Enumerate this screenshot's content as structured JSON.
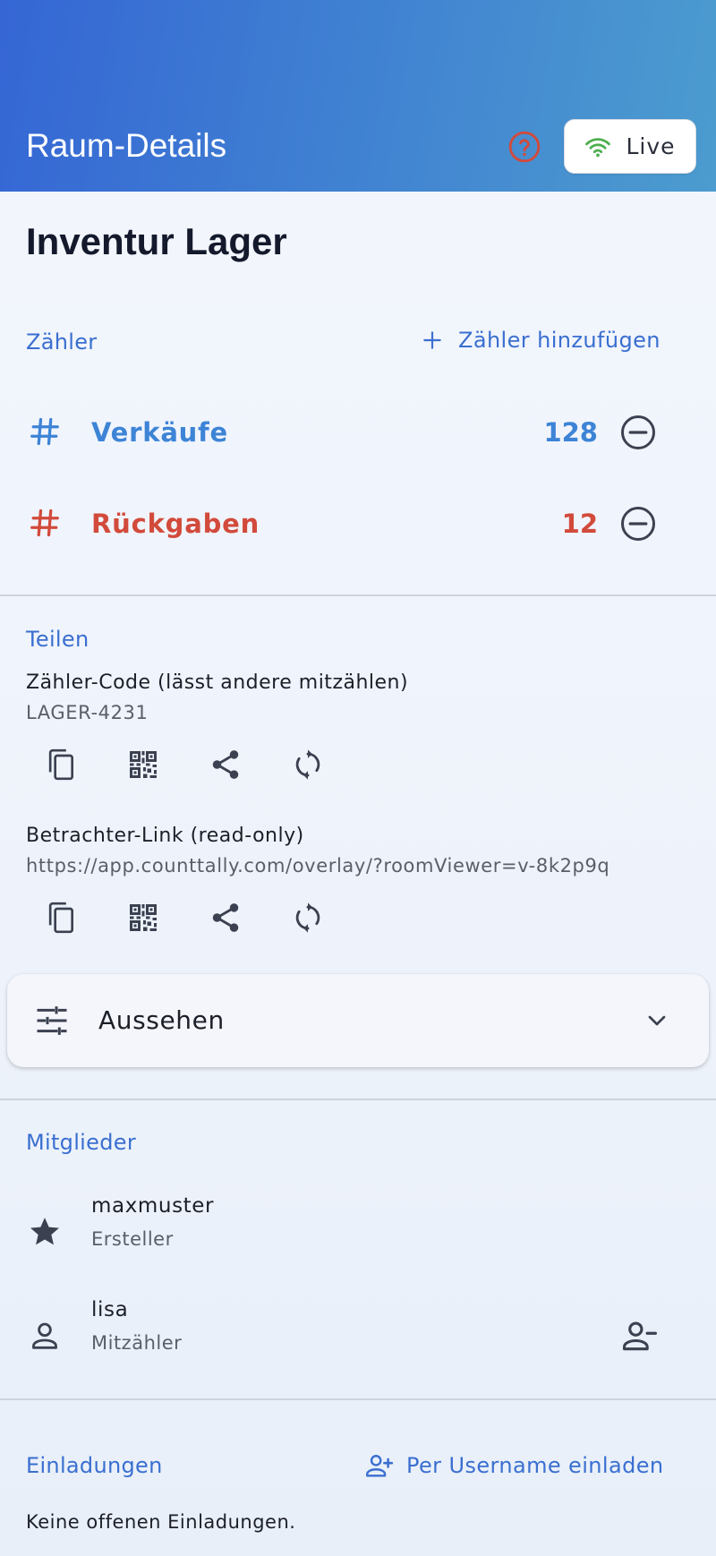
{
  "header": {
    "title": "Raum-Details",
    "live_label": "Live"
  },
  "room": {
    "name": "Inventur Lager"
  },
  "counters_section": {
    "label": "Zähler",
    "add_label": "Zähler hinzufügen",
    "items": [
      {
        "name": "Verkäufe",
        "value": "128",
        "color": "#3d84d6"
      },
      {
        "name": "Rückgaben",
        "value": "12",
        "color": "#d24a3b"
      }
    ]
  },
  "share_section": {
    "label": "Teilen",
    "counter_code": {
      "title": "Zähler-Code (lässt andere mitzählen)",
      "value": "LAGER-4231"
    },
    "viewer_link": {
      "title": "Betrachter-Link (read-only)",
      "value": "https://app.counttally.com/overlay/?roomViewer=v-8k2p9q"
    },
    "actions": [
      "copy-icon",
      "qr-code-icon",
      "share-icon",
      "refresh-icon"
    ]
  },
  "appearance": {
    "label": "Aussehen"
  },
  "members_section": {
    "label": "Mitglieder",
    "items": [
      {
        "name": "maxmuster",
        "role": "Ersteller",
        "icon": "star-icon"
      },
      {
        "name": "lisa",
        "role": "Mitzähler",
        "icon": "person-icon"
      }
    ]
  },
  "invitations_section": {
    "label": "Einladungen",
    "invite_label": "Per Username einladen",
    "empty_text": "Keine offenen Einladungen."
  },
  "colors": {
    "accent": "#3a6fd0",
    "header_start": "#3566d4",
    "header_end": "#4c9ccf",
    "help_red": "#d24a3b",
    "live_green": "#4caf50"
  }
}
